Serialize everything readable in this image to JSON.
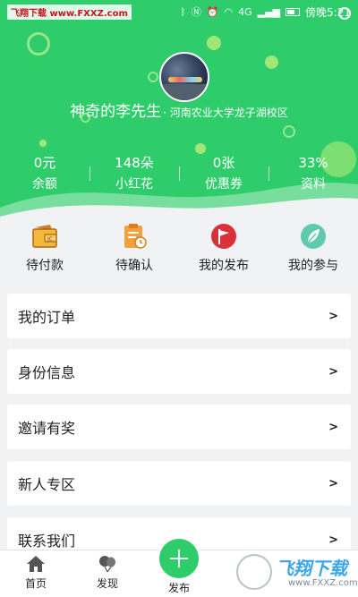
{
  "status_bar": {
    "watermark": "飞翔下载 www.FXXZ.com",
    "signal_text": "4G",
    "time": "傍晚5:21"
  },
  "profile": {
    "name": "神奇的李先生",
    "school": "· 河南农业大学龙子湖校区"
  },
  "stats": [
    {
      "value": "0元",
      "label": "余额"
    },
    {
      "value": "148朵",
      "label": "小红花"
    },
    {
      "value": "0张",
      "label": "优惠券"
    },
    {
      "value": "33%",
      "label": "资料"
    }
  ],
  "quick_actions": [
    {
      "label": "待付款",
      "icon": "wallet-icon"
    },
    {
      "label": "待确认",
      "icon": "clipboard-clock-icon"
    },
    {
      "label": "我的发布",
      "icon": "flag-icon"
    },
    {
      "label": "我的参与",
      "icon": "leaf-icon"
    }
  ],
  "menu": [
    {
      "label": "我的订单",
      "arrow": ">"
    },
    {
      "label": "身份信息",
      "arrow": ">"
    },
    {
      "label": "邀请有奖",
      "arrow": ">"
    },
    {
      "label": "新人专区",
      "arrow": ">"
    },
    {
      "label": "联系我们",
      "arrow": ">"
    }
  ],
  "tabbar": {
    "home": "首页",
    "discover": "发现",
    "publish": "发布"
  },
  "brand_watermark": {
    "text": "飞翔下载",
    "url": "www.FXXZ.com"
  },
  "colors": {
    "accent": "#2ecc6a",
    "background": "#f1f2f4"
  }
}
